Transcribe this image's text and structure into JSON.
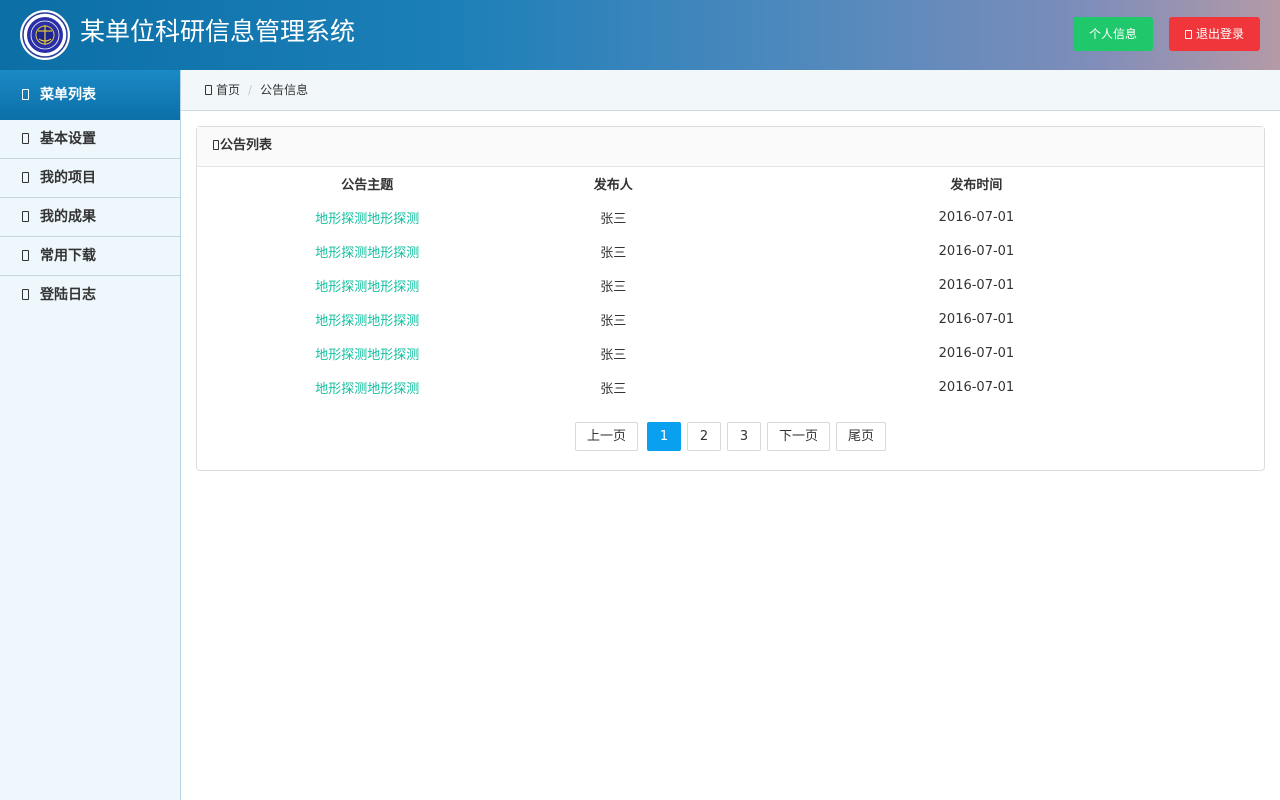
{
  "header": {
    "title": "某单位科研信息管理系统",
    "profile_button": "个人信息",
    "logout_button": "退出登录",
    "profile_color": "#1ec86b",
    "logout_color": "#f0363a"
  },
  "sidebar": {
    "header": "菜单列表",
    "items": [
      {
        "label": "基本设置",
        "icon": "settings-icon"
      },
      {
        "label": "我的项目",
        "icon": "project-icon"
      },
      {
        "label": "我的成果",
        "icon": "achievement-icon"
      },
      {
        "label": "常用下载",
        "icon": "download-icon"
      },
      {
        "label": "登陆日志",
        "icon": "log-icon"
      }
    ]
  },
  "breadcrumb": {
    "home": "首页",
    "current": "公告信息"
  },
  "panel": {
    "title": "公告列表",
    "columns": [
      "公告主题",
      "发布人",
      "发布时间"
    ],
    "rows": [
      {
        "subject": "地形探测地形探测",
        "publisher": "张三",
        "time": "2016-07-01"
      },
      {
        "subject": "地形探测地形探测",
        "publisher": "张三",
        "time": "2016-07-01"
      },
      {
        "subject": "地形探测地形探测",
        "publisher": "张三",
        "time": "2016-07-01"
      },
      {
        "subject": "地形探测地形探测",
        "publisher": "张三",
        "time": "2016-07-01"
      },
      {
        "subject": "地形探测地形探测",
        "publisher": "张三",
        "time": "2016-07-01"
      },
      {
        "subject": "地形探测地形探测",
        "publisher": "张三",
        "time": "2016-07-01"
      }
    ]
  },
  "pagination": {
    "prev": "上一页",
    "pages": [
      "1",
      "2",
      "3"
    ],
    "current": "1",
    "next": "下一页",
    "last": "尾页",
    "active_color": "#0aa0f0"
  }
}
